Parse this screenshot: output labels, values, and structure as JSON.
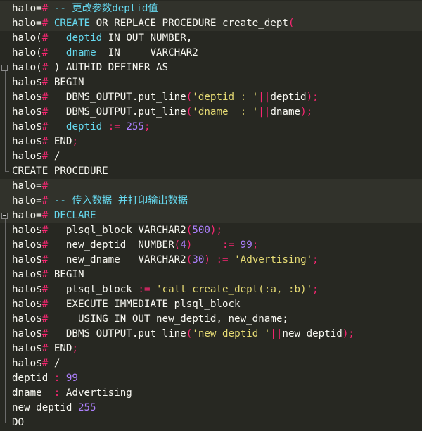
{
  "colors": {
    "background": "#272822",
    "line_highlight": "#31322b",
    "plain": "#f8f8f2",
    "prompt_hash": "#f92672",
    "comment": "#66d9ef",
    "string": "#e6db74",
    "number": "#ae81ff",
    "operator": "#f92672"
  },
  "lines": [
    [
      [
        "p",
        "halo="
      ],
      [
        "h",
        "# "
      ],
      [
        "c",
        "-- 更改参数deptid值"
      ]
    ],
    [
      [
        "p",
        "halo="
      ],
      [
        "h",
        "# "
      ],
      [
        "k",
        "CREATE"
      ],
      [
        "x",
        " OR REPLACE PROCEDURE create_dept"
      ],
      [
        "o",
        "("
      ]
    ],
    [
      [
        "p",
        "halo("
      ],
      [
        "h",
        "# "
      ],
      [
        "x",
        "  "
      ],
      [
        "k",
        "deptid"
      ],
      [
        "x",
        " IN OUT NUMBER,"
      ]
    ],
    [
      [
        "p",
        "halo("
      ],
      [
        "h",
        "# "
      ],
      [
        "x",
        "  "
      ],
      [
        "k",
        "dname"
      ],
      [
        "x",
        "  IN     VARCHAR2"
      ]
    ],
    [
      [
        "p",
        "halo("
      ],
      [
        "h",
        "# "
      ],
      [
        "x",
        ") AUTHID DEFINER AS"
      ]
    ],
    [
      [
        "p",
        "halo$"
      ],
      [
        "h",
        "# "
      ],
      [
        "x",
        "BEGIN"
      ]
    ],
    [
      [
        "p",
        "halo$"
      ],
      [
        "h",
        "# "
      ],
      [
        "x",
        "  DBMS_OUTPUT.put_line"
      ],
      [
        "o",
        "("
      ],
      [
        "s",
        "'deptid : '"
      ],
      [
        "o",
        "||"
      ],
      [
        "x",
        "deptid"
      ],
      [
        "o",
        ");"
      ]
    ],
    [
      [
        "p",
        "halo$"
      ],
      [
        "h",
        "# "
      ],
      [
        "x",
        "  DBMS_OUTPUT.put_line"
      ],
      [
        "o",
        "("
      ],
      [
        "s",
        "'dname  : '"
      ],
      [
        "o",
        "||"
      ],
      [
        "x",
        "dname"
      ],
      [
        "o",
        ");"
      ]
    ],
    [
      [
        "p",
        "halo$"
      ],
      [
        "h",
        "# "
      ],
      [
        "x",
        "  "
      ],
      [
        "k",
        "deptid"
      ],
      [
        "x",
        " "
      ],
      [
        "o",
        ":="
      ],
      [
        "x",
        " "
      ],
      [
        "n",
        "255"
      ],
      [
        "o",
        ";"
      ]
    ],
    [
      [
        "p",
        "halo$"
      ],
      [
        "h",
        "# "
      ],
      [
        "x",
        "END"
      ],
      [
        "o",
        ";"
      ]
    ],
    [
      [
        "p",
        "halo$"
      ],
      [
        "h",
        "# "
      ],
      [
        "x",
        "/"
      ]
    ],
    [
      [
        "x",
        "CREATE PROCEDURE"
      ]
    ],
    [
      [
        "p",
        "halo="
      ],
      [
        "h",
        "#"
      ]
    ],
    [
      [
        "p",
        "halo="
      ],
      [
        "h",
        "# "
      ],
      [
        "c",
        "-- 传入数据 并打印输出数据"
      ]
    ],
    [
      [
        "p",
        "halo="
      ],
      [
        "h",
        "# "
      ],
      [
        "k",
        "DECLARE"
      ]
    ],
    [
      [
        "p",
        "halo$"
      ],
      [
        "h",
        "# "
      ],
      [
        "x",
        "  plsql_block VARCHAR2"
      ],
      [
        "o",
        "("
      ],
      [
        "n",
        "500"
      ],
      [
        "o",
        ");"
      ]
    ],
    [
      [
        "p",
        "halo$"
      ],
      [
        "h",
        "# "
      ],
      [
        "x",
        "  new_deptid  NUMBER"
      ],
      [
        "o",
        "("
      ],
      [
        "n",
        "4"
      ],
      [
        "o",
        ")"
      ],
      [
        "x",
        "     "
      ],
      [
        "o",
        ":="
      ],
      [
        "x",
        " "
      ],
      [
        "n",
        "99"
      ],
      [
        "o",
        ";"
      ]
    ],
    [
      [
        "p",
        "halo$"
      ],
      [
        "h",
        "# "
      ],
      [
        "x",
        "  new_dname   VARCHAR2"
      ],
      [
        "o",
        "("
      ],
      [
        "n",
        "30"
      ],
      [
        "o",
        ")"
      ],
      [
        "x",
        " "
      ],
      [
        "o",
        ":="
      ],
      [
        "x",
        " "
      ],
      [
        "s",
        "'Advertising'"
      ],
      [
        "o",
        ";"
      ]
    ],
    [
      [
        "p",
        "halo$"
      ],
      [
        "h",
        "# "
      ],
      [
        "x",
        "BEGIN"
      ]
    ],
    [
      [
        "p",
        "halo$"
      ],
      [
        "h",
        "# "
      ],
      [
        "x",
        "  plsql_block "
      ],
      [
        "o",
        ":="
      ],
      [
        "x",
        " "
      ],
      [
        "s",
        "'call create_dept(:a, :b)'"
      ],
      [
        "o",
        ";"
      ]
    ],
    [
      [
        "p",
        "halo$"
      ],
      [
        "h",
        "# "
      ],
      [
        "x",
        "  EXECUTE IMMEDIATE plsql_block"
      ]
    ],
    [
      [
        "p",
        "halo$"
      ],
      [
        "h",
        "# "
      ],
      [
        "x",
        "    USING IN OUT new_deptid, new_dname;"
      ]
    ],
    [
      [
        "p",
        "halo$"
      ],
      [
        "h",
        "# "
      ],
      [
        "x",
        "  DBMS_OUTPUT.put_line"
      ],
      [
        "o",
        "("
      ],
      [
        "s",
        "'new_deptid '"
      ],
      [
        "o",
        "||"
      ],
      [
        "x",
        "new_deptid"
      ],
      [
        "o",
        ");"
      ]
    ],
    [
      [
        "p",
        "halo$"
      ],
      [
        "h",
        "# "
      ],
      [
        "x",
        "END"
      ],
      [
        "o",
        ";"
      ]
    ],
    [
      [
        "p",
        "halo$"
      ],
      [
        "h",
        "# "
      ],
      [
        "x",
        "/"
      ]
    ],
    [
      [
        "x",
        "deptid "
      ],
      [
        "o",
        ":"
      ],
      [
        "x",
        " "
      ],
      [
        "n",
        "99"
      ]
    ],
    [
      [
        "x",
        "dname  "
      ],
      [
        "o",
        ":"
      ],
      [
        "x",
        " Advertising"
      ]
    ],
    [
      [
        "x",
        "new_deptid "
      ],
      [
        "n",
        "255"
      ]
    ],
    [
      [
        "x",
        "DO"
      ]
    ]
  ]
}
